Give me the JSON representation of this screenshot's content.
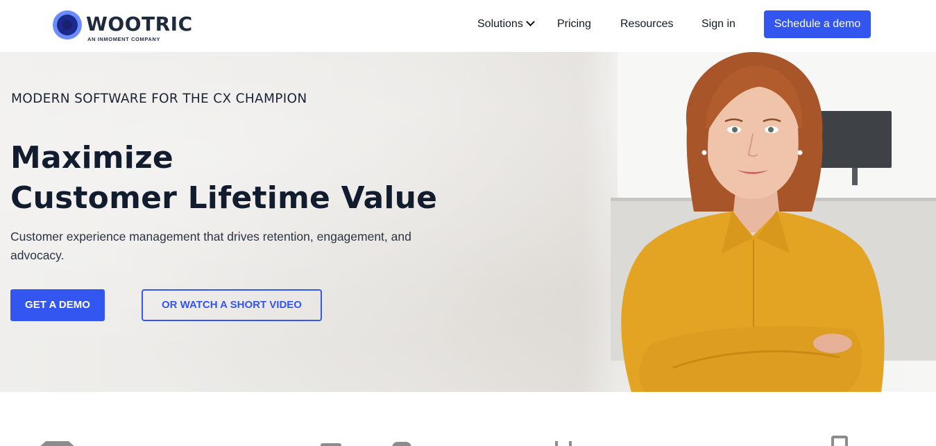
{
  "header": {
    "logo_text": "WOOTRIC",
    "logo_subtext": "AN INMOMENT COMPANY",
    "nav": {
      "solutions": "Solutions",
      "pricing": "Pricing",
      "resources": "Resources",
      "sign_in": "Sign in"
    },
    "cta": "Schedule a demo"
  },
  "hero": {
    "eyebrow": "MODERN SOFTWARE FOR THE CX CHAMPION",
    "title_line1": "Maximize",
    "title_line2": "Customer Lifetime Value",
    "subtitle": "Customer experience management that drives retention, engagement, and advocacy.",
    "primary_button": "GET A DEMO",
    "secondary_button": "OR WATCH A SHORT VIDEO"
  },
  "colors": {
    "accent": "#3355f0",
    "text_dark": "#111c2e",
    "logo_blue": "#6b8cff"
  },
  "icons": {
    "logo": "wootric-eye-logo-icon",
    "solutions_dropdown": "chevron-down-icon",
    "chat": "chat-bot-icon"
  }
}
